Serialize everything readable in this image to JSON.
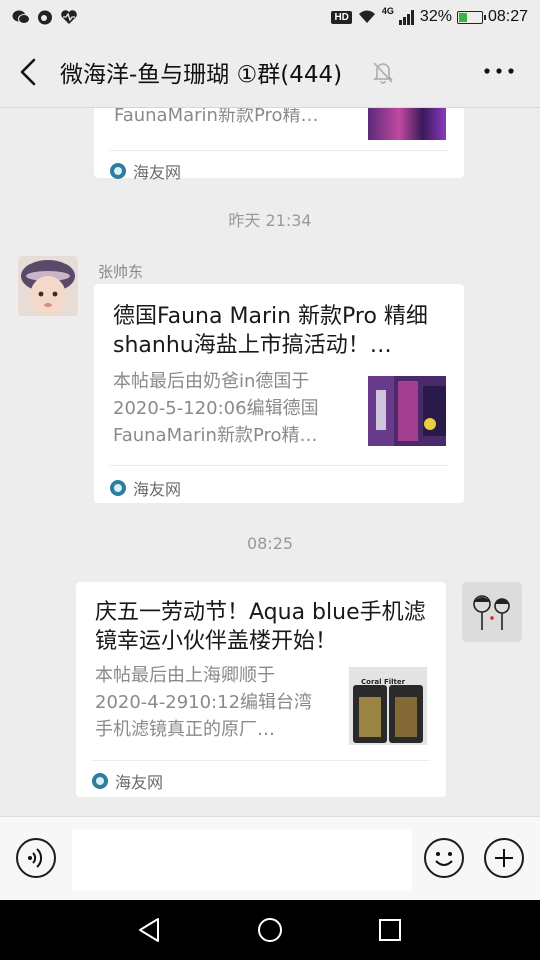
{
  "status_bar": {
    "network_label": "4G",
    "battery": "32%",
    "time": "08:27",
    "hd_label": "HD",
    "battery_level": 0.32
  },
  "header": {
    "title": "微海洋-鱼与珊瑚 ①群(444)",
    "back_icon": "chevron-left-icon",
    "mute_icon": "bell-off-icon",
    "more_icon": "more-dots-icon"
  },
  "messages": [
    {
      "type": "link-card",
      "side": "left",
      "desc_tail": "FaunaMarin新款Pro精…",
      "source": "海友网"
    },
    {
      "type": "timestamp",
      "text": "昨天 21:34"
    },
    {
      "type": "link-card",
      "side": "left",
      "sender": "张帅东",
      "title": "德国Fauna Marin 新款Pro 精细shanhu海盐上市搞活动！…",
      "desc": "本帖最后由奶爸in德国于2020-5-120:06编辑德国FaunaMarin新款Pro精…",
      "source": "海友网"
    },
    {
      "type": "timestamp",
      "text": "08:25"
    },
    {
      "type": "link-card",
      "side": "right",
      "title": "庆五一劳动节！Aqua blue手机滤镜幸运小伙伴盖楼开始！",
      "desc": "本帖最后由上海卿顺于2020-4-2910:12编辑台湾手机滤镜真正的原厂…",
      "thumb_text": "Coral Filter",
      "source": "海友网"
    }
  ],
  "input_bar": {
    "voice_icon": "voice-icon",
    "emoji_icon": "emoji-icon",
    "plus_icon": "plus-icon",
    "input_value": ""
  },
  "nav_bar": {
    "back_icon": "nav-back-icon",
    "home_icon": "nav-home-icon",
    "recent_icon": "nav-recent-icon"
  }
}
